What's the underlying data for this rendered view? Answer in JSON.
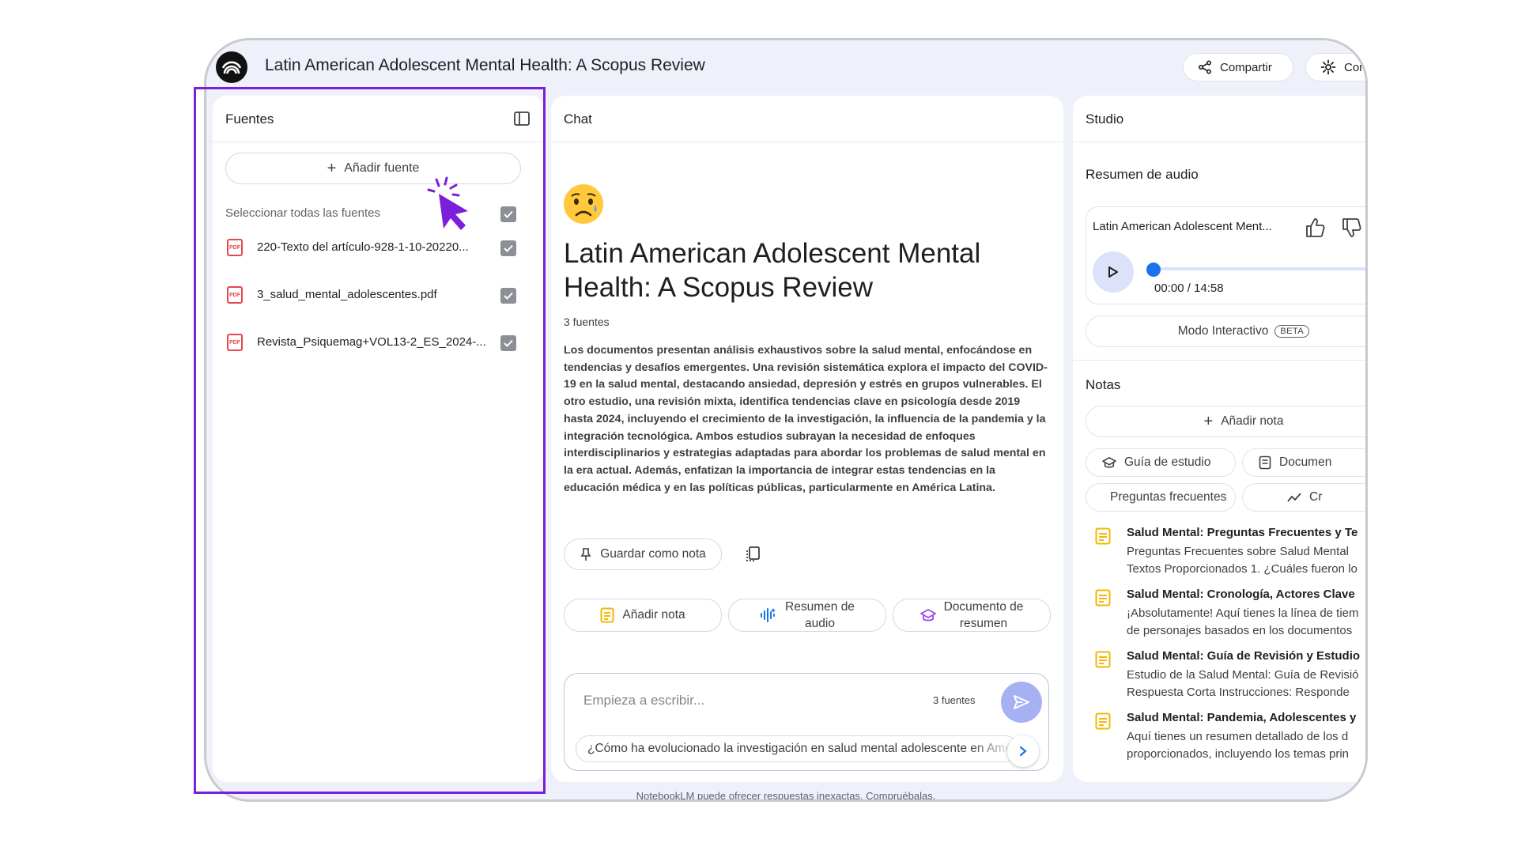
{
  "header": {
    "notebook_title": "Latin American Adolescent Mental Health: A Scopus Review",
    "share_label": "Compartir",
    "config_label": "Con"
  },
  "sources": {
    "title": "Fuentes",
    "add_source_label": "Añadir fuente",
    "select_all_label": "Seleccionar todas las fuentes",
    "items": [
      {
        "name": "220-Texto del artículo-928-1-10-20220...",
        "checked": true
      },
      {
        "name": "3_salud_mental_adolescentes.pdf",
        "checked": true
      },
      {
        "name": "Revista_Psiquemag+VOL13-2_ES_2024-...",
        "checked": true
      }
    ]
  },
  "chat": {
    "title": "Chat",
    "heading": "Latin American Adolescent Mental Health: A Scopus Review",
    "source_count": "3 fuentes",
    "summary": "Los documentos presentan análisis exhaustivos sobre la salud mental, enfocándose en tendencias y desafíos emergentes. Una revisión sistemática explora el impacto del COVID-19 en la salud mental, destacando ansiedad, depresión y estrés en grupos vulnerables. El otro estudio, una revisión mixta, identifica tendencias clave en psicología desde 2019 hasta 2024, incluyendo el crecimiento de la investigación, la influencia de la pandemia y la integración tecnológica. Ambos estudios subrayan la necesidad de enfoques interdisciplinarios y estrategias adaptadas para abordar los problemas de salud mental en la era actual. Además, enfatizan la importancia de integrar estas tendencias en la educación médica y en las políticas públicas, particularmente en América Latina.",
    "save_note_label": "Guardar como nota",
    "add_note_label": "Añadir nota",
    "audio_summary_line1": "Resumen de",
    "audio_summary_line2": "audio",
    "doc_summary_line1": "Documento de",
    "doc_summary_line2": "resumen",
    "input_placeholder": "Empieza a escribir...",
    "input_source_count": "3 fuentes",
    "suggestion": "¿Cómo ha evolucionado la investigación en salud mental adolescente en América Latina?"
  },
  "studio": {
    "title": "Studio",
    "audio_section_title": "Resumen de audio",
    "audio_title": "Latin American Adolescent Ment...",
    "audio_time": "00:00 / 14:58",
    "audio_progress": 0,
    "interactive_label": "Modo Interactivo",
    "beta_label": "BETA",
    "notes_title": "Notas",
    "add_note_label": "Añadir nota",
    "chips": [
      {
        "label": "Guía de estudio",
        "icon": "graduation-cap-icon"
      },
      {
        "label": "Documen",
        "icon": "document-icon"
      },
      {
        "label": "Preguntas frecuentes",
        "icon": "chat-bubble-icon"
      },
      {
        "label": "Cr",
        "icon": "trend-icon"
      }
    ],
    "notes": [
      {
        "title": "Salud Mental: Preguntas Frecuentes y Te",
        "line1": "Preguntas Frecuentes sobre Salud Mental",
        "line2": "Textos Proporcionados 1. ¿Cuáles fueron lo"
      },
      {
        "title": "Salud Mental: Cronología, Actores Clave",
        "line1": "¡Absolutamente! Aquí tienes la línea de tiem",
        "line2": "de personajes basados en los documentos"
      },
      {
        "title": "Salud Mental: Guía de Revisión y Estudio",
        "line1": "Estudio de la Salud Mental: Guía de Revisió",
        "line2": "Respuesta Corta Instrucciones: Responde"
      },
      {
        "title": "Salud Mental: Pandemia, Adolescentes y",
        "line1": "Aquí tienes un resumen detallado de los d",
        "line2": "proporcionados, incluyendo los temas prin"
      }
    ]
  },
  "footer": {
    "disclaimer": "NotebookLM puede ofrecer respuestas inexactas. Compruébalas."
  },
  "colors": {
    "accent": "#7b1fdb",
    "app_background": "#eef1fa",
    "send_button": "#a6b1f3",
    "progress": "#1a73e8",
    "pdf_icon": "#e5484d",
    "note_icon": "#f2b705"
  }
}
